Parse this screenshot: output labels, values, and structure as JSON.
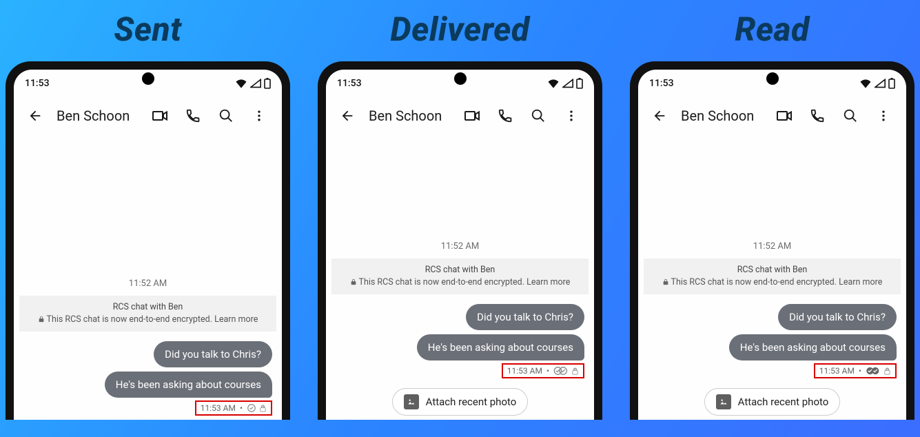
{
  "labels": {
    "sent": "Sent",
    "delivered": "Delivered",
    "read": "Read"
  },
  "statusbar": {
    "time": "11:53"
  },
  "header": {
    "contact_name": "Ben Schoon"
  },
  "chat": {
    "date_separator": "11:52 AM",
    "rcs_line1": "RCS chat with Ben",
    "rcs_line2": "This RCS chat is now end-to-end encrypted.",
    "learn_more": "Learn more",
    "msg1": "Did you talk to Chris?",
    "msg2": "He's been asking about courses",
    "timestamp": "11:53 AM",
    "dot": "•",
    "attach_label": "Attach recent photo"
  }
}
